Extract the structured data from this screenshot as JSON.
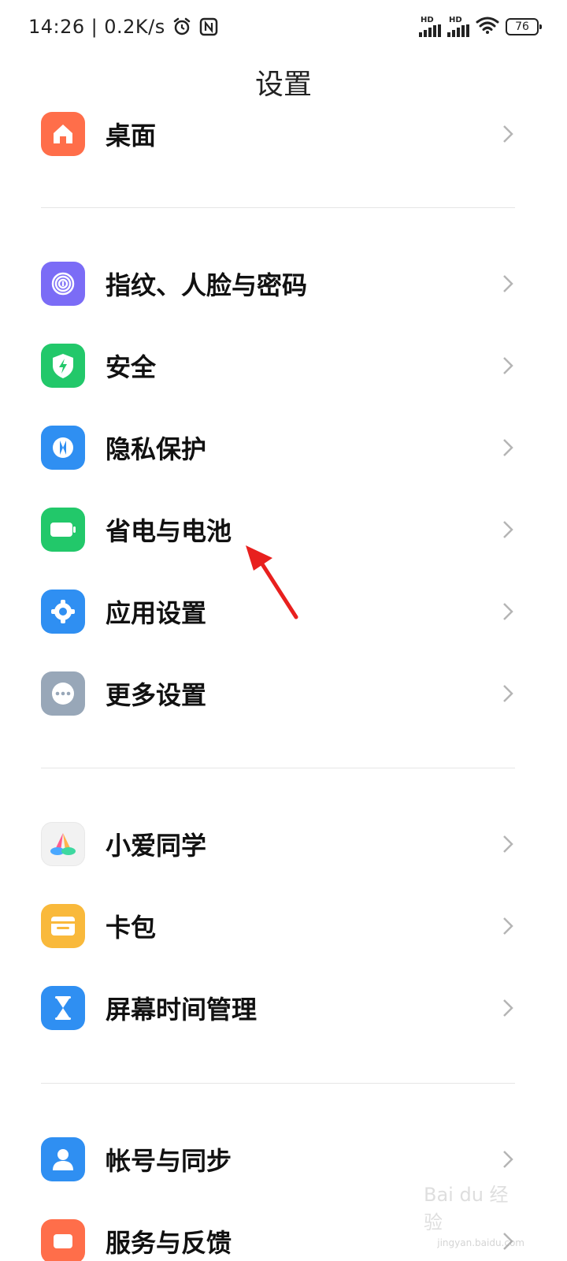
{
  "status_bar": {
    "time": "14:26",
    "speed": "0.2K/s",
    "hd1": "HD",
    "hd2": "HD",
    "battery": "76"
  },
  "header": {
    "title": "设置"
  },
  "settings": {
    "items": [
      {
        "label": "桌面",
        "icon": "home-icon",
        "color": "#FF6E4A"
      },
      {
        "label": "指纹、人脸与密码",
        "icon": "fingerprint-icon",
        "color": "#7B6CF6"
      },
      {
        "label": "安全",
        "icon": "shield-bolt-icon",
        "color": "#22C86A"
      },
      {
        "label": "隐私保护",
        "icon": "privacy-icon",
        "color": "#2F8FF2"
      },
      {
        "label": "省电与电池",
        "icon": "battery-icon",
        "color": "#22C86A"
      },
      {
        "label": "应用设置",
        "icon": "gear-icon",
        "color": "#2F8FF2"
      },
      {
        "label": "更多设置",
        "icon": "more-icon",
        "color": "#98A7B8"
      },
      {
        "label": "小爱同学",
        "icon": "xiaoai-icon",
        "color": "#F2F2F2"
      },
      {
        "label": "卡包",
        "icon": "wallet-icon",
        "color": "#F9B93B"
      },
      {
        "label": "屏幕时间管理",
        "icon": "hourglass-icon",
        "color": "#2F8FF2"
      },
      {
        "label": "帐号与同步",
        "icon": "account-icon",
        "color": "#2F8FF2"
      },
      {
        "label": "服务与反馈",
        "icon": "service-icon",
        "color": "#FF6E4A"
      }
    ]
  },
  "watermark": {
    "text": "Bai du 经验",
    "sub": "jingyan.baidu.com"
  }
}
